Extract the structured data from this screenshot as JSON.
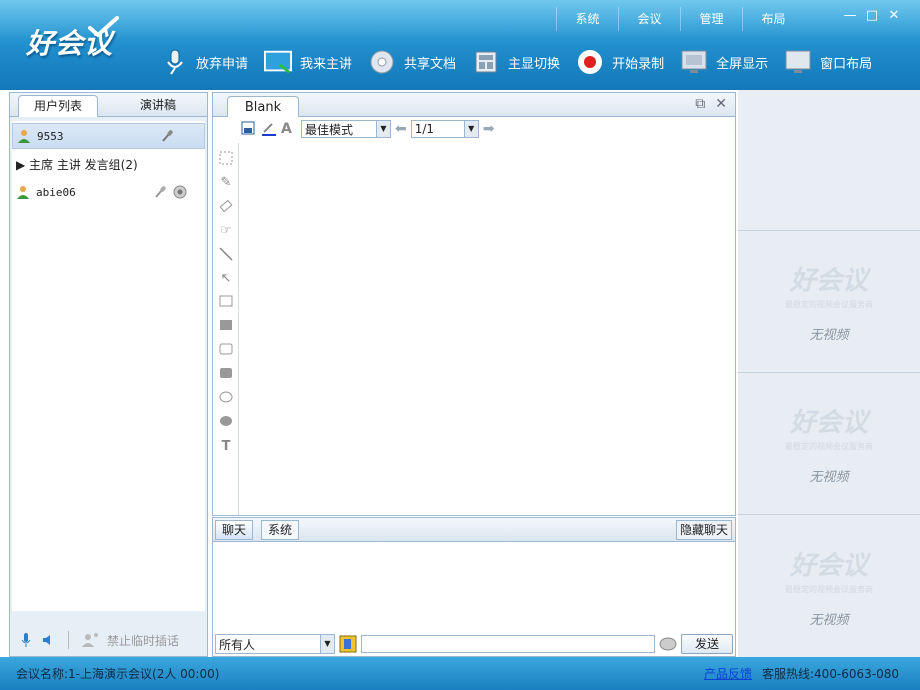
{
  "app": {
    "logo": "好会议"
  },
  "topnav": [
    "系统",
    "会议",
    "管理",
    "布局"
  ],
  "toolbar": [
    {
      "label": "放弃申请",
      "icon": "microphone-icon"
    },
    {
      "label": "我来主讲",
      "icon": "presenter-screen-icon"
    },
    {
      "label": "共享文档",
      "icon": "share-document-icon"
    },
    {
      "label": "主显切换",
      "icon": "layout-switch-icon"
    },
    {
      "label": "开始录制",
      "icon": "record-icon"
    },
    {
      "label": "全屏显示",
      "icon": "fullscreen-icon"
    },
    {
      "label": "窗口布局",
      "icon": "window-layout-icon"
    }
  ],
  "left_panel": {
    "tabs": [
      "用户列表",
      "演讲稿"
    ],
    "users": [
      {
        "name": "9553"
      },
      {
        "name": "▶ 主席 主讲 发言组(2)"
      },
      {
        "name": "abie06"
      }
    ],
    "footer_label": "禁止临时插话"
  },
  "whiteboard": {
    "tab": "Blank",
    "mode": "最佳模式",
    "page": "1/1"
  },
  "chat": {
    "tabs": [
      "聊天",
      "系统"
    ],
    "hide_label": "隐藏聊天",
    "recipient": "所有人",
    "send_label": "发送"
  },
  "video": {
    "logo": "好会议",
    "slogan": "最稳定的视频会议服务商",
    "no_video": "无视频"
  },
  "status": {
    "meeting": "会议名称:1-上海演示会议(2人 00:00)",
    "feedback": "产品反馈",
    "hotline": "客服热线:400-6063-080"
  },
  "colors": {
    "header": "#1f8ccb",
    "accent": "#3fb4e6",
    "record": "#e02020"
  }
}
